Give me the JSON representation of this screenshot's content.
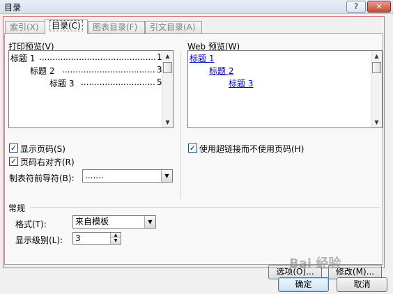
{
  "window": {
    "title": "目录",
    "help_label": "?",
    "close_label": "✕"
  },
  "tabs": [
    {
      "label": "索引(X)",
      "active": false
    },
    {
      "label": "目录(C)",
      "active": true
    },
    {
      "label": "图表目录(F)",
      "active": false
    },
    {
      "label": "引文目录(A)",
      "active": false
    }
  ],
  "print_preview": {
    "label": "打印预览(V)",
    "entries": [
      {
        "text": "标题 1",
        "page": "1"
      },
      {
        "text": "标题 2",
        "page": "3"
      },
      {
        "text": "标题 3",
        "page": "5"
      }
    ],
    "dots": "..............................................."
  },
  "web_preview": {
    "label": "Web 预览(W)",
    "entries": [
      "标题 1",
      "标题 2",
      "标题 3"
    ]
  },
  "options": {
    "show_page_numbers": {
      "label": "显示页码(S)",
      "checked": true
    },
    "right_align": {
      "label": "页码右对齐(R)",
      "checked": true
    },
    "use_hyperlinks": {
      "label": "使用超链接而不使用页码(H)",
      "checked": true
    },
    "tab_leader": {
      "label": "制表符前导符(B):",
      "value": "......."
    }
  },
  "general": {
    "heading": "常规",
    "format": {
      "label": "格式(T):",
      "value": "来自模板"
    },
    "levels": {
      "label": "显示级别(L):",
      "value": "3"
    }
  },
  "buttons": {
    "options": "选项(O)...",
    "modify": "修改(M)...",
    "ok": "确定",
    "cancel": "取消"
  },
  "watermark": "Bai 经验",
  "icons": {
    "check": "✓",
    "arrow_down": "▼",
    "arrow_up": "▲"
  }
}
